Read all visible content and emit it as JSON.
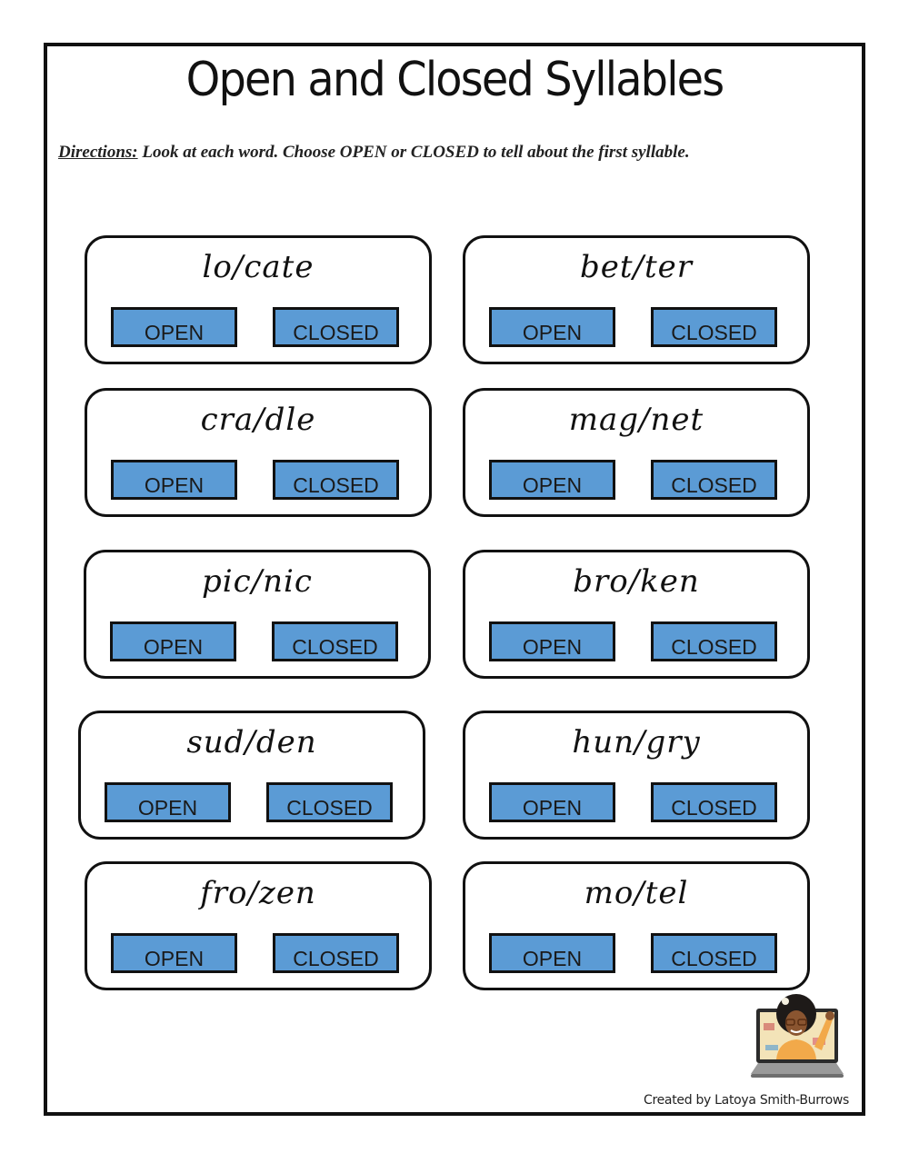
{
  "title": "Open and Closed Syllables",
  "directions": {
    "lead": "Directions:",
    "text": "  Look at each word.  Choose OPEN or CLOSED to tell about the first syllable."
  },
  "cards": [
    {
      "word": "lo/cate",
      "open_label": "OPEN",
      "closed_label": "CLOSED"
    },
    {
      "word": "bet/ter",
      "open_label": "OPEN",
      "closed_label": "CLOSED"
    },
    {
      "word": "cra/dle",
      "open_label": "OPEN",
      "closed_label": "CLOSED"
    },
    {
      "word": "mag/net",
      "open_label": "OPEN",
      "closed_label": "CLOSED"
    },
    {
      "word": "pic/nic",
      "open_label": "OPEN",
      "closed_label": "CLOSED"
    },
    {
      "word": "bro/ken",
      "open_label": "OPEN",
      "closed_label": "CLOSED"
    },
    {
      "word": "sud/den",
      "open_label": "OPEN",
      "closed_label": "CLOSED"
    },
    {
      "word": "hun/gry",
      "open_label": "OPEN",
      "closed_label": "CLOSED"
    },
    {
      "word": "fro/zen",
      "open_label": "OPEN",
      "closed_label": "CLOSED"
    },
    {
      "word": "mo/tel",
      "open_label": "OPEN",
      "closed_label": "CLOSED"
    }
  ],
  "credit": "Created by Latoya Smith-Burrows",
  "colors": {
    "button": "#5b9bd5",
    "border": "#111111"
  },
  "icons": {
    "avatar": "teacher-laptop-avatar-icon"
  }
}
